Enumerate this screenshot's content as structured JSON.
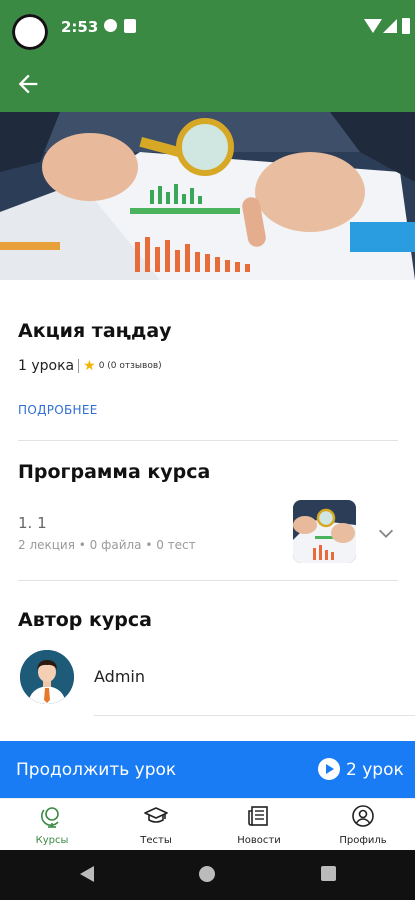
{
  "status_bar": {
    "time": "2:53"
  },
  "course": {
    "title": "Акция таңдау",
    "lessons_count": "1 урока",
    "rating": "0 (0 отзывов)",
    "more_link": "ПОДРОБНЕЕ"
  },
  "program": {
    "heading": "Программа курса",
    "lesson": {
      "number": "1. 1",
      "details": "2 лекция • 0 файла • 0 тест"
    }
  },
  "author": {
    "heading": "Автор курса",
    "name": "Admin"
  },
  "continue_bar": {
    "label": "Продолжить урок",
    "count": "2 урок"
  },
  "bottom_nav": {
    "items": [
      {
        "label": "Курсы",
        "icon": "globe-icon",
        "active": true
      },
      {
        "label": "Тесты",
        "icon": "graduation-cap-icon",
        "active": false
      },
      {
        "label": "Новости",
        "icon": "newspaper-icon",
        "active": false
      },
      {
        "label": "Профиль",
        "icon": "user-circle-icon",
        "active": false
      }
    ]
  },
  "colors": {
    "app_bar": "#3b8a43",
    "accent": "#1a7cf5",
    "link": "#2f6fd6",
    "active_nav": "#3b8a43"
  }
}
